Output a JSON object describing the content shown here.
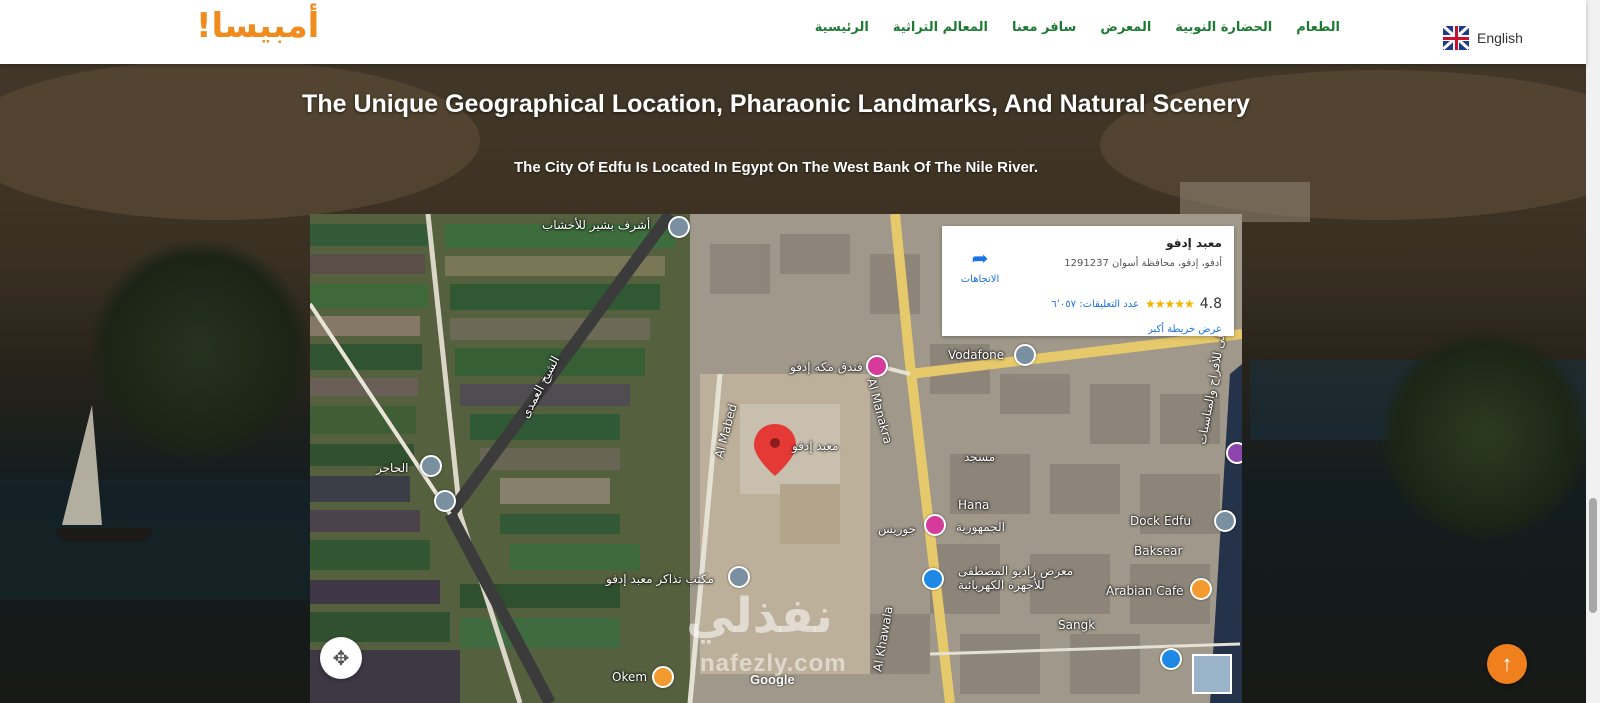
{
  "header": {
    "logo_text": "أمبيسا!",
    "nav": [
      {
        "label": "الرئيسية"
      },
      {
        "label": "المعالم التراثية"
      },
      {
        "label": "سافر معنا"
      },
      {
        "label": "المعرض"
      },
      {
        "label": "الحضارة النوبية"
      },
      {
        "label": "الطعام"
      }
    ],
    "language": "English",
    "language_icon": "uk-flag-icon"
  },
  "main": {
    "title": "The Unique Geographical Location, Pharaonic Landmarks, And Natural Scenery",
    "subtitle": "The City Of Edfu Is Located In Egypt On The West Bank Of The Nile River."
  },
  "map": {
    "card": {
      "name": "معبد إدفو",
      "address": "أدفو، إدفو، محافظة أسوان 1291237",
      "rating": "4.8",
      "stars": "★★★★★",
      "reviews": "عدد التعليقات: ٦٬٠٥٧",
      "more_link": "عرض خريطة أكبر",
      "directions_label": "الاتجاهات",
      "directions_icon": "directions-icon"
    },
    "labels": {
      "ashraf": "أشرف بشير للأخشاب",
      "hotel": "فندق مكه إدفو",
      "temple": "معبد إدفو",
      "al_mabed": "Al Mabed",
      "al_manakra": "Al Manakra",
      "vodafone": "Vodafone",
      "al_hager": "الحاجر",
      "al_sheikh": "الشيخ العمدى",
      "hana": "Hana",
      "masjid": "مسجد",
      "jomhoria": "الجمهورية",
      "joris": "جوريس",
      "ticket": "مكتب تذاكر معبد إدفو",
      "dock": "Dock Edfu",
      "baksear": "Baksear",
      "arabian_cafe": "Arabian Cafe",
      "radio": "معرض راديو المصطفى للأجهزة الكهربائية",
      "sangk": "Sangk",
      "okem": "Okem",
      "khawala": "Al Khawala",
      "qaa": "قاعة ليالى للأفراح والمناسبات",
      "google": "Google"
    },
    "fullscreen_icon": "fullscreen-icon"
  },
  "watermark": {
    "arabic": "نفذلي",
    "domain": "nafezly.com"
  },
  "scroll_top_icon": "arrow-up-icon"
}
